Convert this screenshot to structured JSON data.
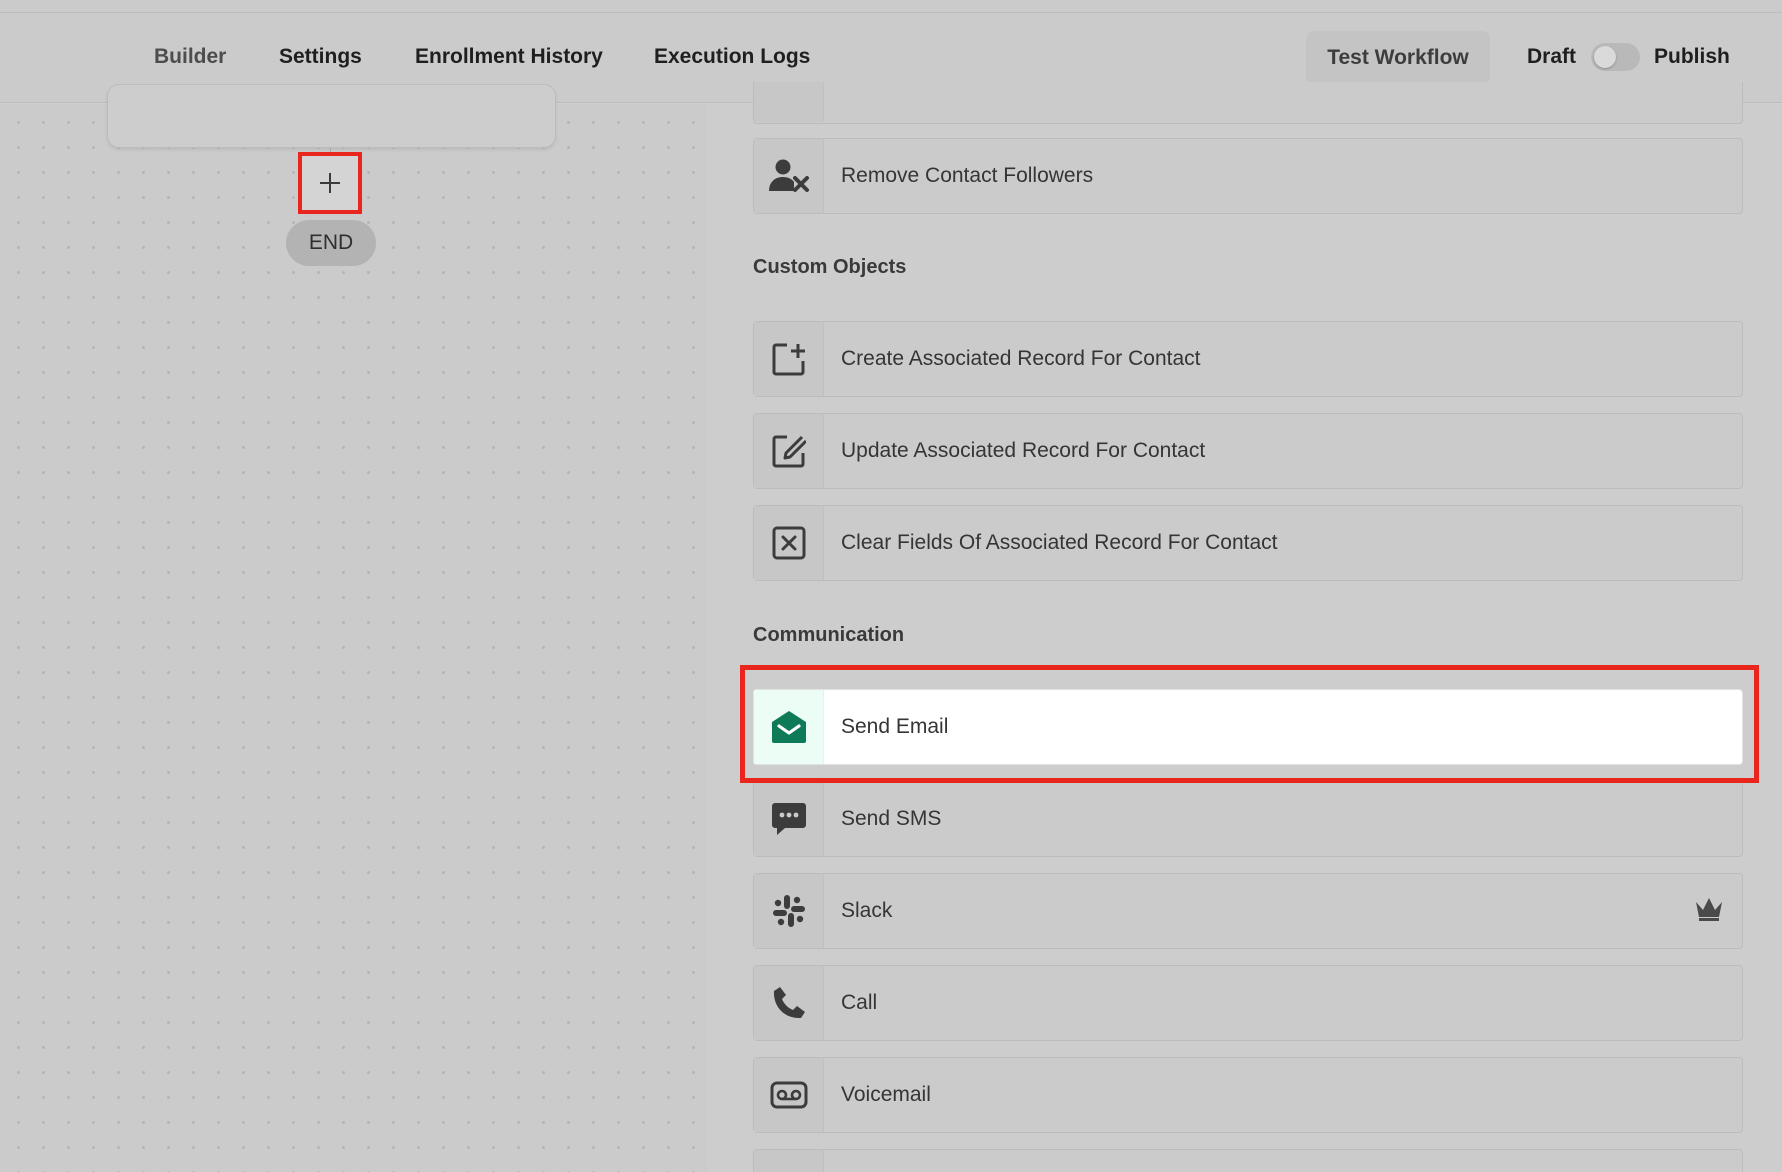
{
  "header": {
    "tabs": [
      {
        "label": "Builder",
        "active": true
      },
      {
        "label": "Settings",
        "active": false
      },
      {
        "label": "Enrollment History",
        "active": false
      },
      {
        "label": "Execution Logs",
        "active": false
      }
    ],
    "test_button": "Test Workflow",
    "draft_label": "Draft",
    "publish_label": "Publish",
    "publish_toggle_on": false
  },
  "canvas": {
    "add_step_symbol": "+",
    "end_label": "END"
  },
  "panel": {
    "items_top": [
      {
        "label": "Remove Contact Followers",
        "icon": "user-remove-icon"
      }
    ],
    "sections": [
      {
        "title": "Custom Objects",
        "items": [
          {
            "label": "Create Associated Record For Contact",
            "icon": "create-record-icon"
          },
          {
            "label": "Update Associated Record For Contact",
            "icon": "edit-record-icon"
          },
          {
            "label": "Clear Fields Of Associated Record For Contact",
            "icon": "clear-record-icon"
          }
        ]
      },
      {
        "title": "Communication",
        "items": [
          {
            "label": "Send Email",
            "icon": "email-icon",
            "highlighted": true
          },
          {
            "label": "Send SMS",
            "icon": "sms-icon"
          },
          {
            "label": "Slack",
            "icon": "slack-icon",
            "premium": true
          },
          {
            "label": "Call",
            "icon": "phone-icon"
          },
          {
            "label": "Voicemail",
            "icon": "voicemail-icon"
          }
        ]
      }
    ]
  },
  "colors": {
    "highlight_border": "#e8261d",
    "email_icon": "#0e7a57",
    "email_icon_bg": "#ecfdf5",
    "overlay_gray": "#cbcbcb"
  }
}
